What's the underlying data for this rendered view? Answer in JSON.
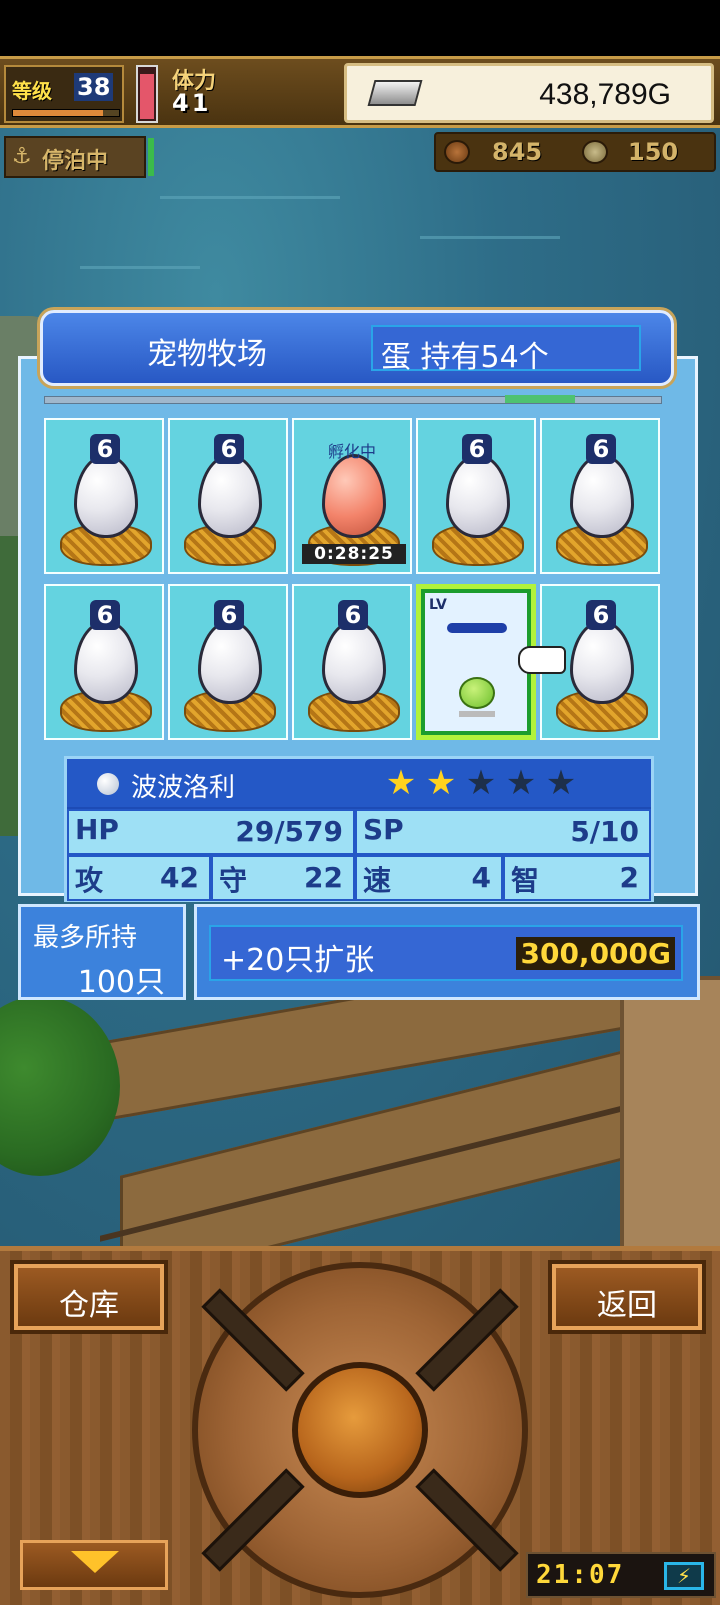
{
  "hud": {
    "level_label": "等级",
    "level_value": "38",
    "level_progress": 0.85,
    "stamina_label": "体力",
    "stamina_value": "41",
    "stamina_fill": 0.9,
    "gold_value": "438,789G",
    "ingot_icon": "silver-ingot-icon"
  },
  "status": {
    "anchor_text": "停泊中",
    "anchor_icon": "anchor-icon"
  },
  "resources": [
    {
      "icon": "meat-icon",
      "value": "845"
    },
    {
      "icon": "medal-icon",
      "value": "150"
    }
  ],
  "panel": {
    "title": "宠物牧场",
    "tab_label": "蛋 持有54个"
  },
  "eggs": [
    {
      "type": "egg",
      "num": "6"
    },
    {
      "type": "egg",
      "num": "6"
    },
    {
      "type": "hatching",
      "label": "孵化中",
      "timer": "0:28:25"
    },
    {
      "type": "egg",
      "num": "6"
    },
    {
      "type": "egg",
      "num": "6"
    },
    {
      "type": "egg",
      "num": "6"
    },
    {
      "type": "egg",
      "num": "6"
    },
    {
      "type": "egg",
      "num": "6"
    },
    {
      "type": "pet",
      "lv_label": "LV"
    },
    {
      "type": "egg",
      "num": "6"
    }
  ],
  "info": {
    "name": "波波洛利",
    "stars_filled": 2,
    "stars_total": 5,
    "stats": {
      "hp_key": "HP",
      "hp_val": "29/579",
      "sp_key": "SP",
      "sp_val": "5/10",
      "atk_key": "攻",
      "atk_val": "42",
      "def_key": "守",
      "def_val": "22",
      "spd_key": "速",
      "spd_val": "4",
      "int_key": "智",
      "int_val": "2"
    }
  },
  "capacity": {
    "label": "最多所持",
    "value": "100只"
  },
  "expand": {
    "label": "+20只扩张",
    "price": "300,000G"
  },
  "controls": {
    "warehouse_label": "仓库",
    "back_label": "返回"
  },
  "clock": {
    "time": "21:07",
    "battery_icon": "battery-charging-icon"
  },
  "colors": {
    "panel_blue": "#3c82dc",
    "cell_cyan": "#64d3e0",
    "gold_text": "#ffd83a",
    "select_green": "#b2f23c"
  }
}
